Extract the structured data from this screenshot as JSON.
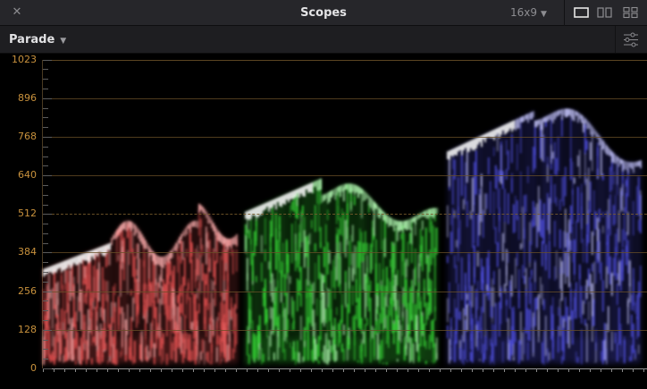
{
  "window": {
    "title": "Scopes",
    "aspect_ratio": "16x9",
    "close_icon": "close-icon",
    "layout_icons": [
      "single-view-icon",
      "dual-view-icon",
      "quad-view-icon"
    ]
  },
  "toolbar": {
    "scope_type": "Parade",
    "settings_icon": "sliders-icon"
  },
  "scope": {
    "y_labels": [
      "1023",
      "896",
      "768",
      "640",
      "512",
      "384",
      "256",
      "128",
      "0"
    ],
    "y_values": [
      1023,
      896,
      768,
      640,
      512,
      384,
      256,
      128,
      0
    ],
    "y_range": [
      0,
      1023
    ],
    "dashed_reference": 512,
    "channels": [
      {
        "name": "red",
        "color": "#ff5a5a"
      },
      {
        "name": "green",
        "color": "#3cf03c"
      },
      {
        "name": "blue",
        "color": "#5a5aff"
      }
    ],
    "colors": {
      "label": "#c9923d",
      "grid": "#6a4f27"
    }
  }
}
